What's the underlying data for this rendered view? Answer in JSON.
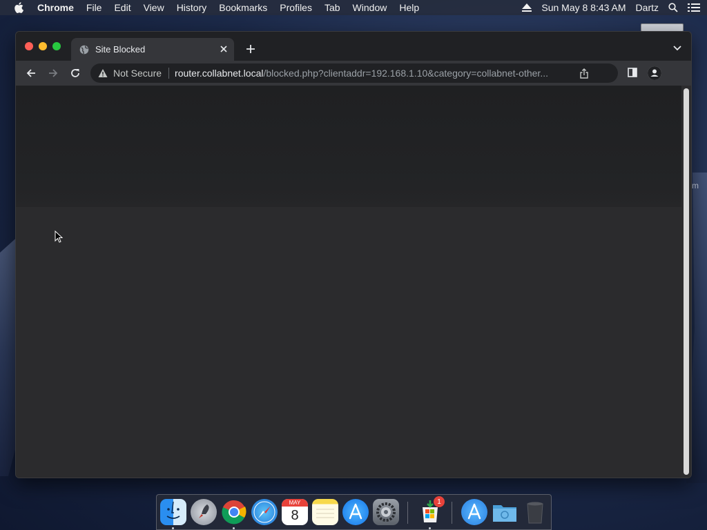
{
  "menubar": {
    "app_name": "Chrome",
    "items": [
      "File",
      "Edit",
      "View",
      "History",
      "Bookmarks",
      "Profiles",
      "Tab",
      "Window",
      "Help"
    ],
    "datetime": "Sun May 8  8:43 AM",
    "user": "Dartz"
  },
  "desktop": {
    "partial_label": "m"
  },
  "browser": {
    "tab": {
      "title": "Site Blocked"
    },
    "omnibox": {
      "security_label": "Not Secure",
      "host": "router.collabnet.local",
      "path": "/blocked.php?clientaddr=192.168.1.10&category=collabnet-other..."
    }
  },
  "dock": {
    "apps": [
      "finder-icon",
      "launchpad-icon",
      "chrome-icon",
      "safari-icon",
      "calendar-icon",
      "notes-icon",
      "app-store-icon",
      "system-preferences-icon",
      "microsoft-installer-icon",
      "applications-folder-icon",
      "downloads-folder-icon",
      "trash-icon"
    ],
    "calendar": {
      "month": "MAY",
      "day": "8"
    },
    "badge_count": "1"
  },
  "colors": {
    "close": "#ff5f57",
    "minimize": "#febc2e",
    "maximize": "#28c840",
    "chrome_dark": "#202124",
    "toolbar": "#35363a"
  }
}
